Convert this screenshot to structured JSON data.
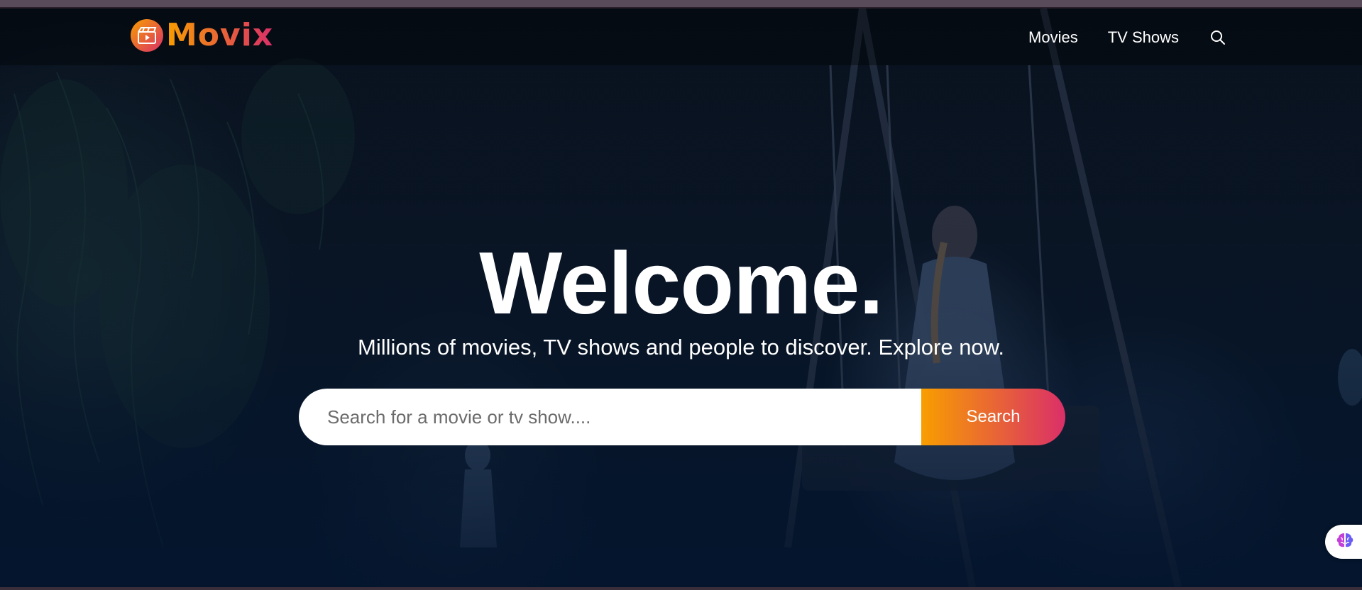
{
  "app": {
    "logo_text": "Movix",
    "brand_gradient": [
      "#f89e00",
      "#da2f68"
    ],
    "background_color": "#04152d"
  },
  "header": {
    "nav": [
      {
        "label": "Movies"
      },
      {
        "label": "TV Shows"
      }
    ],
    "search_icon": "search-icon"
  },
  "hero": {
    "title": "Welcome.",
    "subtitle": "Millions of movies, TV shows and people to discover. Explore now.",
    "search": {
      "placeholder": "Search for a movie or tv show....",
      "value": "",
      "button_label": "Search"
    }
  },
  "widgets": {
    "assistant_icon": "brain-icon"
  }
}
